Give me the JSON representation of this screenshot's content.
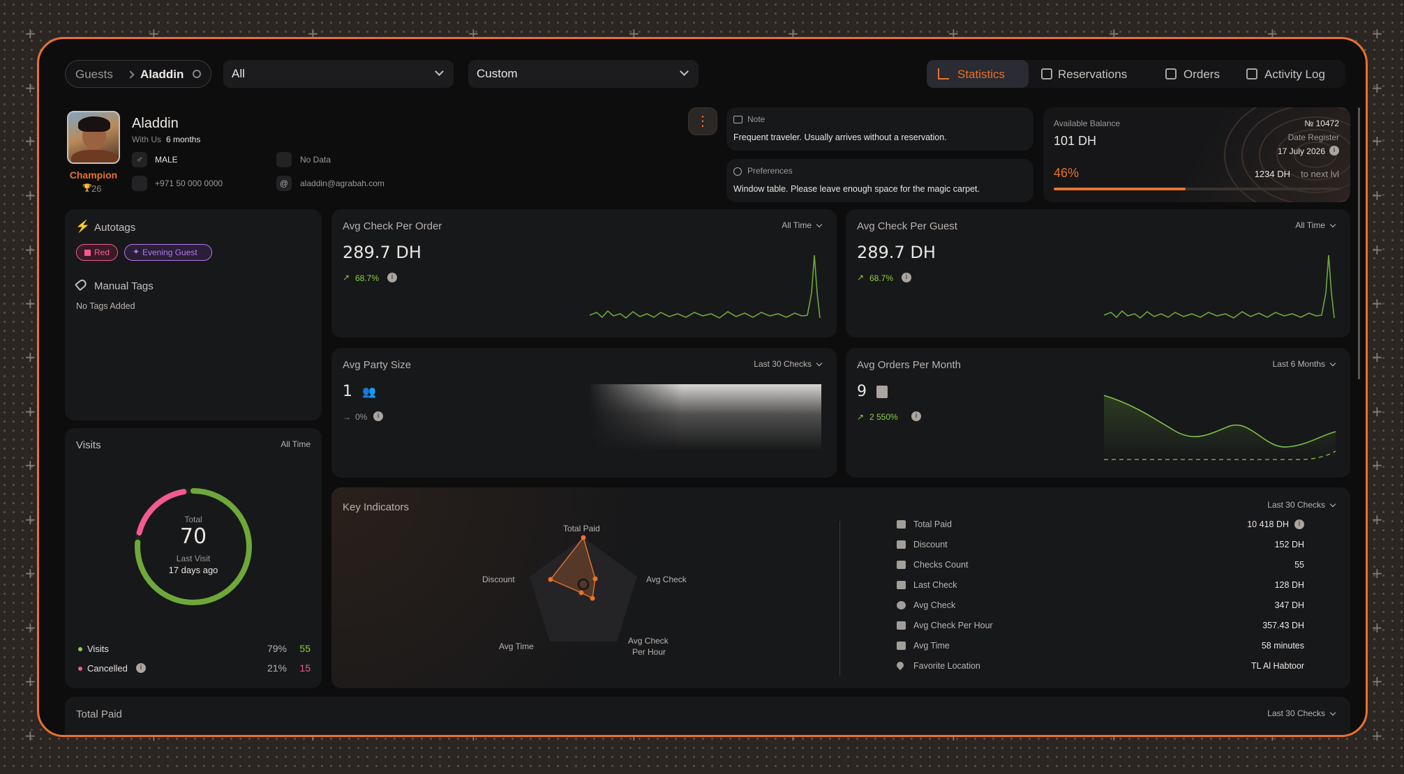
{
  "breadcrumb": {
    "root": "Guests",
    "current": "Aladdin"
  },
  "filters": {
    "first": "All",
    "second": "Custom"
  },
  "tabs": [
    {
      "label": "Statistics",
      "active": true
    },
    {
      "label": "Reservations",
      "active": false
    },
    {
      "label": "Orders",
      "active": false
    },
    {
      "label": "Activity Log",
      "active": false
    }
  ],
  "profile": {
    "name": "Aladdin",
    "with_us_prefix": "With Us",
    "with_us_value": "6 months",
    "rank": "Champion",
    "rank_points": "26",
    "gender": "MALE",
    "phone": "+971 50 000 0000",
    "birthday": "No Data",
    "email": "aladdin@agrabah.com",
    "more_button": "⋮"
  },
  "note": {
    "title": "Note",
    "text": "Frequent traveler. Usually arrives without a reservation."
  },
  "preferences": {
    "title": "Preferences",
    "text": "Window table. Please leave enough space for the magic carpet."
  },
  "balance": {
    "title": "Available Balance",
    "value": "101 DH",
    "number": "№ 10472",
    "date_label": "Date Register",
    "date": "17 July 2026",
    "percent_label": "46%",
    "percent": 0.46,
    "next_level_value": "1234 DH",
    "next_level_suffix": "to next lvl"
  },
  "autotags": {
    "title": "Autotags",
    "tags": [
      {
        "label": "Red",
        "color": "#f25a90"
      },
      {
        "label": "Evening Guest",
        "color": "#b07ae8"
      }
    ],
    "manual_title": "Manual Tags",
    "manual_empty": "No Tags Added"
  },
  "visits": {
    "title": "Visits",
    "period": "All Time",
    "total_label": "Total",
    "total": "70",
    "last_visit_label": "Last Visit",
    "last_visit": "17 days ago",
    "rows": [
      {
        "label": "Visits",
        "pct": "79%",
        "count": "55",
        "color": "#8bd13e"
      },
      {
        "label": "Cancelled",
        "pct": "21%",
        "count": "15",
        "color": "#f25a90"
      }
    ],
    "visits_fraction": 0.79
  },
  "metrics": {
    "avg_check_order": {
      "title": "Avg Check Per Order",
      "period": "All Time",
      "value": "289.7 DH",
      "change": "68.7%"
    },
    "avg_check_guest": {
      "title": "Avg Check Per Guest",
      "period": "All Time",
      "value": "289.7 DH",
      "change": "68.7%"
    },
    "avg_party": {
      "title": "Avg Party Size",
      "period": "Last 30 Checks",
      "value": "1",
      "change": "0%"
    },
    "avg_orders_month": {
      "title": "Avg Orders Per Month",
      "period": "Last 6 Months",
      "value": "9",
      "change": "2 550%"
    }
  },
  "key_indicators": {
    "title": "Key Indicators",
    "period": "Last 30 Checks",
    "radar_labels": [
      "Total Paid",
      "Avg Check",
      "Avg Check",
      "Per Hour",
      "Avg Time",
      "Discount"
    ],
    "rows": [
      {
        "label": "Total Paid",
        "value": "10 418 DH"
      },
      {
        "label": "Discount",
        "value": "152 DH"
      },
      {
        "label": "Checks Count",
        "value": "55"
      },
      {
        "label": "Last Check",
        "value": "128 DH"
      },
      {
        "label": "Avg Check",
        "value": "347 DH"
      },
      {
        "label": "Avg Check Per Hour",
        "value": "357.43 DH"
      },
      {
        "label": "Avg Time",
        "value": "58 minutes"
      },
      {
        "label": "Favorite Location",
        "value": "TL Al Habtoor"
      }
    ]
  },
  "total_paid": {
    "title": "Total Paid",
    "period": "Last 30 Checks"
  },
  "colors": {
    "accent": "#e8722c",
    "green": "#8bd13e",
    "pink": "#f25a90",
    "panel": "#17181a"
  }
}
